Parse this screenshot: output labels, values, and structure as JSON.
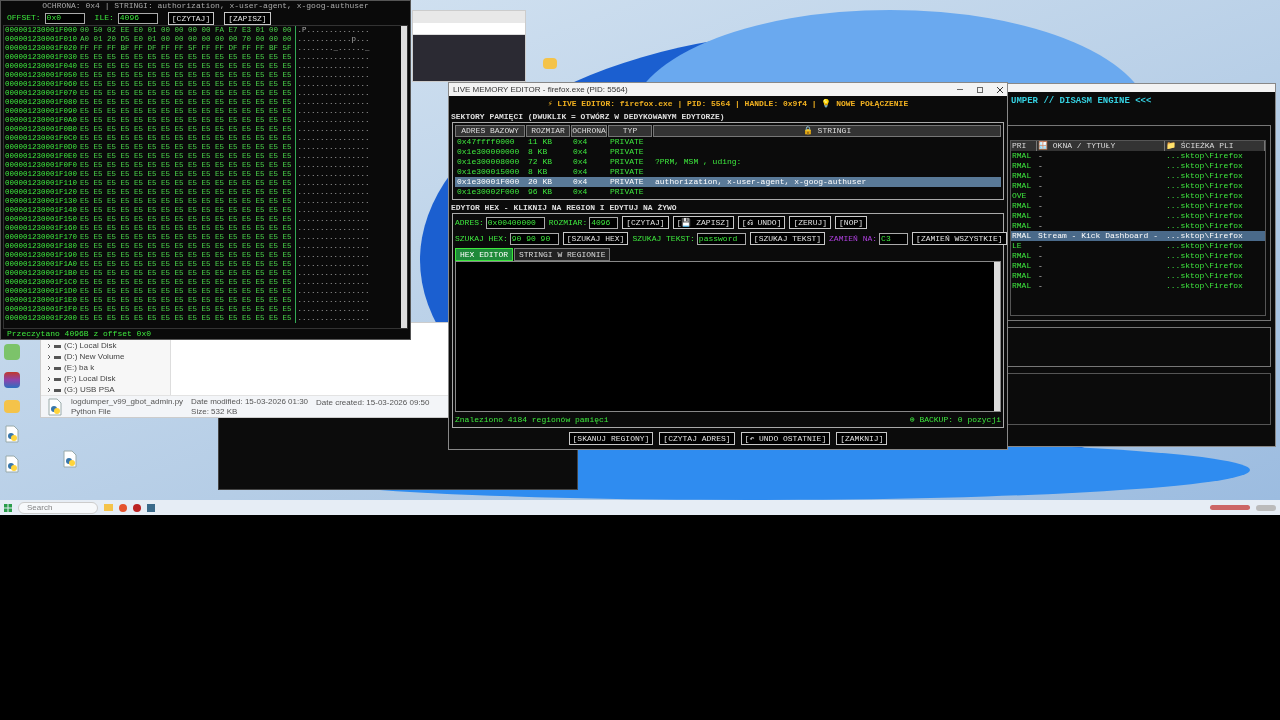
{
  "hex_window": {
    "info": "OCHRONA: 0x4 | STRINGI: authorization, x-user-agent, x-goog-authuser",
    "fields": [
      {
        "label": "OFFSET:",
        "value": "0x0"
      },
      {
        "label": "ILE:",
        "value": "4096"
      }
    ],
    "buttons": [
      "[CZYTAJ]",
      "[ZAPISZ]"
    ],
    "rows": [
      {
        "address": "000001230001F000",
        "bytes": "00 50 02 EE E0 01 00 00 00 00 FA E7 E3 01 00 00",
        "ascii": ".P.............."
      },
      {
        "address": "000001230001F010",
        "bytes": "A0 01 20 D5 E0 01 00 00 00 00 00 00 70 00 00 00",
        "ascii": "............p..."
      },
      {
        "address": "000001230001F020",
        "bytes": "FF FF FF BF FF DF FF FF 5F FF FF DF FF FF BF 5F",
        "ascii": "........_......_"
      },
      {
        "address": "000001230001F030",
        "bytes": "E5 E5 E5 E5 E5 E5 E5 E5 E5 E5 E5 E5 E5 E5 E5 E5",
        "ascii": "................"
      },
      {
        "address": "000001230001F040",
        "bytes": "E5 E5 E5 E5 E5 E5 E5 E5 E5 E5 E5 E5 E5 E5 E5 E5",
        "ascii": "................"
      },
      {
        "address": "000001230001F050",
        "bytes": "E5 E5 E5 E5 E5 E5 E5 E5 E5 E5 E5 E5 E5 E5 E5 E5",
        "ascii": "................"
      },
      {
        "address": "000001230001F060",
        "bytes": "E5 E5 E5 E5 E5 E5 E5 E5 E5 E5 E5 E5 E5 E5 E5 E5",
        "ascii": "................"
      },
      {
        "address": "000001230001F070",
        "bytes": "E5 E5 E5 E5 E5 E5 E5 E5 E5 E5 E5 E5 E5 E5 E5 E5",
        "ascii": "................"
      },
      {
        "address": "000001230001F080",
        "bytes": "E5 E5 E5 E5 E5 E5 E5 E5 E5 E5 E5 E5 E5 E5 E5 E5",
        "ascii": "................"
      },
      {
        "address": "000001230001F090",
        "bytes": "E5 E5 E5 E5 E5 E5 E5 E5 E5 E5 E5 E5 E5 E5 E5 E5",
        "ascii": "................"
      },
      {
        "address": "000001230001F0A0",
        "bytes": "E5 E5 E5 E5 E5 E5 E5 E5 E5 E5 E5 E5 E5 E5 E5 E5",
        "ascii": "................"
      },
      {
        "address": "000001230001F0B0",
        "bytes": "E5 E5 E5 E5 E5 E5 E5 E5 E5 E5 E5 E5 E5 E5 E5 E5",
        "ascii": "................"
      },
      {
        "address": "000001230001F0C0",
        "bytes": "E5 E5 E5 E5 E5 E5 E5 E5 E5 E5 E5 E5 E5 E5 E5 E5",
        "ascii": "................"
      },
      {
        "address": "000001230001F0D0",
        "bytes": "E5 E5 E5 E5 E5 E5 E5 E5 E5 E5 E5 E5 E5 E5 E5 E5",
        "ascii": "................"
      },
      {
        "address": "000001230001F0E0",
        "bytes": "E5 E5 E5 E5 E5 E5 E5 E5 E5 E5 E5 E5 E5 E5 E5 E5",
        "ascii": "................"
      },
      {
        "address": "000001230001F0F0",
        "bytes": "E5 E5 E5 E5 E5 E5 E5 E5 E5 E5 E5 E5 E5 E5 E5 E5",
        "ascii": "................"
      },
      {
        "address": "000001230001F100",
        "bytes": "E5 E5 E5 E5 E5 E5 E5 E5 E5 E5 E5 E5 E5 E5 E5 E5",
        "ascii": "................"
      },
      {
        "address": "000001230001F110",
        "bytes": "E5 E5 E5 E5 E5 E5 E5 E5 E5 E5 E5 E5 E5 E5 E5 E5",
        "ascii": "................"
      },
      {
        "address": "000001230001F120",
        "bytes": "E5 E5 E5 E5 E5 E5 E5 E5 E5 E5 E5 E5 E5 E5 E5 E5",
        "ascii": "................"
      },
      {
        "address": "000001230001F130",
        "bytes": "E5 E5 E5 E5 E5 E5 E5 E5 E5 E5 E5 E5 E5 E5 E5 E5",
        "ascii": "................"
      },
      {
        "address": "000001230001F140",
        "bytes": "E5 E5 E5 E5 E5 E5 E5 E5 E5 E5 E5 E5 E5 E5 E5 E5",
        "ascii": "................"
      },
      {
        "address": "000001230001F150",
        "bytes": "E5 E5 E5 E5 E5 E5 E5 E5 E5 E5 E5 E5 E5 E5 E5 E5",
        "ascii": "................"
      },
      {
        "address": "000001230001F160",
        "bytes": "E5 E5 E5 E5 E5 E5 E5 E5 E5 E5 E5 E5 E5 E5 E5 E5",
        "ascii": "................"
      },
      {
        "address": "000001230001F170",
        "bytes": "E5 E5 E5 E5 E5 E5 E5 E5 E5 E5 E5 E5 E5 E5 E5 E5",
        "ascii": "................"
      },
      {
        "address": "000001230001F180",
        "bytes": "E5 E5 E5 E5 E5 E5 E5 E5 E5 E5 E5 E5 E5 E5 E5 E5",
        "ascii": "................"
      },
      {
        "address": "000001230001F190",
        "bytes": "E5 E5 E5 E5 E5 E5 E5 E5 E5 E5 E5 E5 E5 E5 E5 E5",
        "ascii": "................"
      },
      {
        "address": "000001230001F1A0",
        "bytes": "E5 E5 E5 E5 E5 E5 E5 E5 E5 E5 E5 E5 E5 E5 E5 E5",
        "ascii": "................"
      },
      {
        "address": "000001230001F1B0",
        "bytes": "E5 E5 E5 E5 E5 E5 E5 E5 E5 E5 E5 E5 E5 E5 E5 E5",
        "ascii": "................"
      },
      {
        "address": "000001230001F1C0",
        "bytes": "E5 E5 E5 E5 E5 E5 E5 E5 E5 E5 E5 E5 E5 E5 E5 E5",
        "ascii": "................"
      },
      {
        "address": "000001230001F1D0",
        "bytes": "E5 E5 E5 E5 E5 E5 E5 E5 E5 E5 E5 E5 E5 E5 E5 E5",
        "ascii": "................"
      },
      {
        "address": "000001230001F1E0",
        "bytes": "E5 E5 E5 E5 E5 E5 E5 E5 E5 E5 E5 E5 E5 E5 E5 E5",
        "ascii": "................"
      },
      {
        "address": "000001230001F1F0",
        "bytes": "E5 E5 E5 E5 E5 E5 E5 E5 E5 E5 E5 E5 E5 E5 E5 E5",
        "ascii": "................"
      },
      {
        "address": "000001230001F200",
        "bytes": "E5 E5 E5 E5 E5 E5 E5 E5 E5 E5 E5 E5 E5 E5 E5 E5",
        "ascii": "................"
      }
    ],
    "status": "Przeczytano 4096B z offset 0x0"
  },
  "explorer": {
    "tree": [
      {
        "label": "(C:) Local Disk"
      },
      {
        "label": "(D:) New Volume"
      },
      {
        "label": "(E:) ba k"
      },
      {
        "label": "(F:) Local Disk"
      },
      {
        "label": "(G:) USB PSA"
      }
    ],
    "file": {
      "name": "logdumper_v99_gbot_admin.py",
      "type": "Python File",
      "modified_label": "Date modified:",
      "modified": "15-03-2026 01:30",
      "size_label": "Size:",
      "size": "532 KB",
      "created_label": "Date created:",
      "created": "15-03-2026 09:50"
    }
  },
  "editor": {
    "title": "LIVE MEMORY EDITOR - firefox.exe (PID: 5564)",
    "header": "⚡ LIVE EDITOR: firefox.exe | PID: 5564 | HANDLE: 0x9f4 | 💡 NOWE POŁĄCZENIE",
    "sectors_label": "SEKTORY PAMIĘCI (DWUKLIK = OTWÓRZ W DEDYKOWANYM EDYTORZE)",
    "columns": [
      "ADRES BAZOWY",
      "ROZMIAR",
      "OCHRONA",
      "TYP",
      "🔒 STRINGI"
    ],
    "rows": [
      {
        "cells": [
          "0x47ffff0000",
          "11 KB",
          "0x4",
          "PRIVATE",
          ""
        ],
        "selected": false
      },
      {
        "cells": [
          "0x1e300000000",
          "8 KB",
          "0x4",
          "PRIVATE",
          ""
        ],
        "selected": false
      },
      {
        "cells": [
          "0x1e300008000",
          "72 KB",
          "0x4",
          "PRIVATE",
          "?PRM, MSM , uding:"
        ],
        "selected": false
      },
      {
        "cells": [
          "0x1e300015000",
          "8 KB",
          "0x4",
          "PRIVATE",
          ""
        ],
        "selected": false
      },
      {
        "cells": [
          "0x1e30001F000",
          "20 KB",
          "0x4",
          "PRIVATE",
          "authorization, x-user-agent, x-goog-authuser"
        ],
        "selected": true
      },
      {
        "cells": [
          "0x1e30002F000",
          "96 KB",
          "0x4",
          "PRIVATE",
          ""
        ],
        "selected": false
      }
    ],
    "hex_label": "EDYTOR HEX - KLIKNIJ NA REGION I EDYTUJ NA ŻYWO",
    "row1": [
      {
        "kind": "field",
        "label": "ADRES:",
        "value": "0x00400000"
      },
      {
        "kind": "field",
        "label": "ROZMIAR:",
        "value": "4096"
      },
      {
        "kind": "button",
        "label": "[CZYTAJ]"
      },
      {
        "kind": "button",
        "label": "[💾 ZAPISZ]"
      },
      {
        "kind": "button",
        "label": "[⎌ UNDO]"
      },
      {
        "kind": "button",
        "label": "[ZERUJ]"
      },
      {
        "kind": "button",
        "label": "[NOP]"
      }
    ],
    "row2": [
      {
        "kind": "field",
        "label": "SZUKAJ HEX:",
        "value": "90 90 90"
      },
      {
        "kind": "button",
        "label": "[SZUKAJ HEX]"
      },
      {
        "kind": "field",
        "label": "SZUKAJ TEKST:",
        "value": "password"
      },
      {
        "kind": "button",
        "label": "[SZUKAJ TEKST]"
      },
      {
        "kind": "accent_field",
        "label": "ZAMIEŃ NA:",
        "value": "C3"
      },
      {
        "kind": "button",
        "label": "[ZAMIEŃ WSZYSTKIE]"
      }
    ],
    "tabs": [
      {
        "label": "HEX EDITOR",
        "selected": true
      },
      {
        "label": "STRINGI W REGIONIE",
        "selected": false
      }
    ],
    "status": "Znaleziono 4184 regionów pamięci",
    "backup": "⊕ BACKUP: 0 pozycji",
    "buttons": [
      "[SKANUJ REGIONY]",
      "[CZYTAJ ADRES]",
      "[↶ UNDO OSTATNIE]",
      "[ZAMKNIJ]"
    ]
  },
  "dumper": {
    "header": "UMPER // DISASM ENGINE <<<",
    "columns": [
      "PRI",
      "🪟 OKNA / TYTUŁY",
      "📁 ŚCIEŻKA PLI"
    ],
    "rows": [
      {
        "cells": [
          "RMAL",
          "-",
          "...sktop\\Firefox"
        ],
        "selected": false
      },
      {
        "cells": [
          "RMAL",
          "-",
          "...sktop\\Firefox"
        ],
        "selected": false
      },
      {
        "cells": [
          "RMAL",
          "-",
          "...sktop\\Firefox"
        ],
        "selected": false
      },
      {
        "cells": [
          "RMAL",
          "-",
          "...sktop\\Firefox"
        ],
        "selected": false
      },
      {
        "cells": [
          "OVE",
          "-",
          "...sktop\\Firefox"
        ],
        "selected": false
      },
      {
        "cells": [
          "RMAL",
          "-",
          "...sktop\\Firefox"
        ],
        "selected": false
      },
      {
        "cells": [
          "RMAL",
          "-",
          "...sktop\\Firefox"
        ],
        "selected": false
      },
      {
        "cells": [
          "RMAL",
          "-",
          "...sktop\\Firefox"
        ],
        "selected": false
      },
      {
        "cells": [
          "RMAL",
          "Stream - Kick Dashboard -",
          "...sktop\\Firefox"
        ],
        "selected": true
      },
      {
        "cells": [
          "LE",
          "-",
          "...sktop\\Firefox"
        ],
        "selected": false
      },
      {
        "cells": [
          "RMAL",
          "-",
          "...sktop\\Firefox"
        ],
        "selected": false
      },
      {
        "cells": [
          "RMAL",
          "-",
          "...sktop\\Firefox"
        ],
        "selected": false
      },
      {
        "cells": [
          "RMAL",
          "-",
          "...sktop\\Firefox"
        ],
        "selected": false
      },
      {
        "cells": [
          "RMAL",
          "-",
          "...sktop\\Firefox"
        ],
        "selected": false
      }
    ]
  },
  "taskbar": {
    "search_placeholder": "Search"
  }
}
